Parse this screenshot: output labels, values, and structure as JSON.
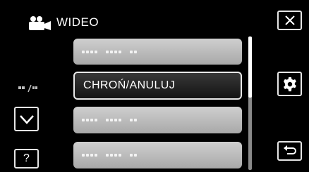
{
  "header": {
    "title": "WIDEO",
    "camera_icon": "video-camera-icon"
  },
  "indicator": {
    "icon": "protect-indicator-icon"
  },
  "nav": {
    "down_icon": "chevron-down-icon",
    "help_label": "?"
  },
  "toolbar": {
    "close_icon": "close-icon",
    "settings_icon": "gear-icon",
    "back_icon": "return-icon"
  },
  "menu": {
    "items": [
      {
        "label": "",
        "state": "disabled"
      },
      {
        "label": "CHROŃ/ANULUJ",
        "state": "selected"
      },
      {
        "label": "",
        "state": "disabled"
      },
      {
        "label": "",
        "state": "disabled"
      }
    ]
  },
  "scrollbar": {
    "thumb_fraction": 0.46
  },
  "colors": {
    "background": "#000000",
    "item_dim": "#bdbdbd",
    "item_selected": "#262626",
    "border": "#e6e6e6"
  }
}
